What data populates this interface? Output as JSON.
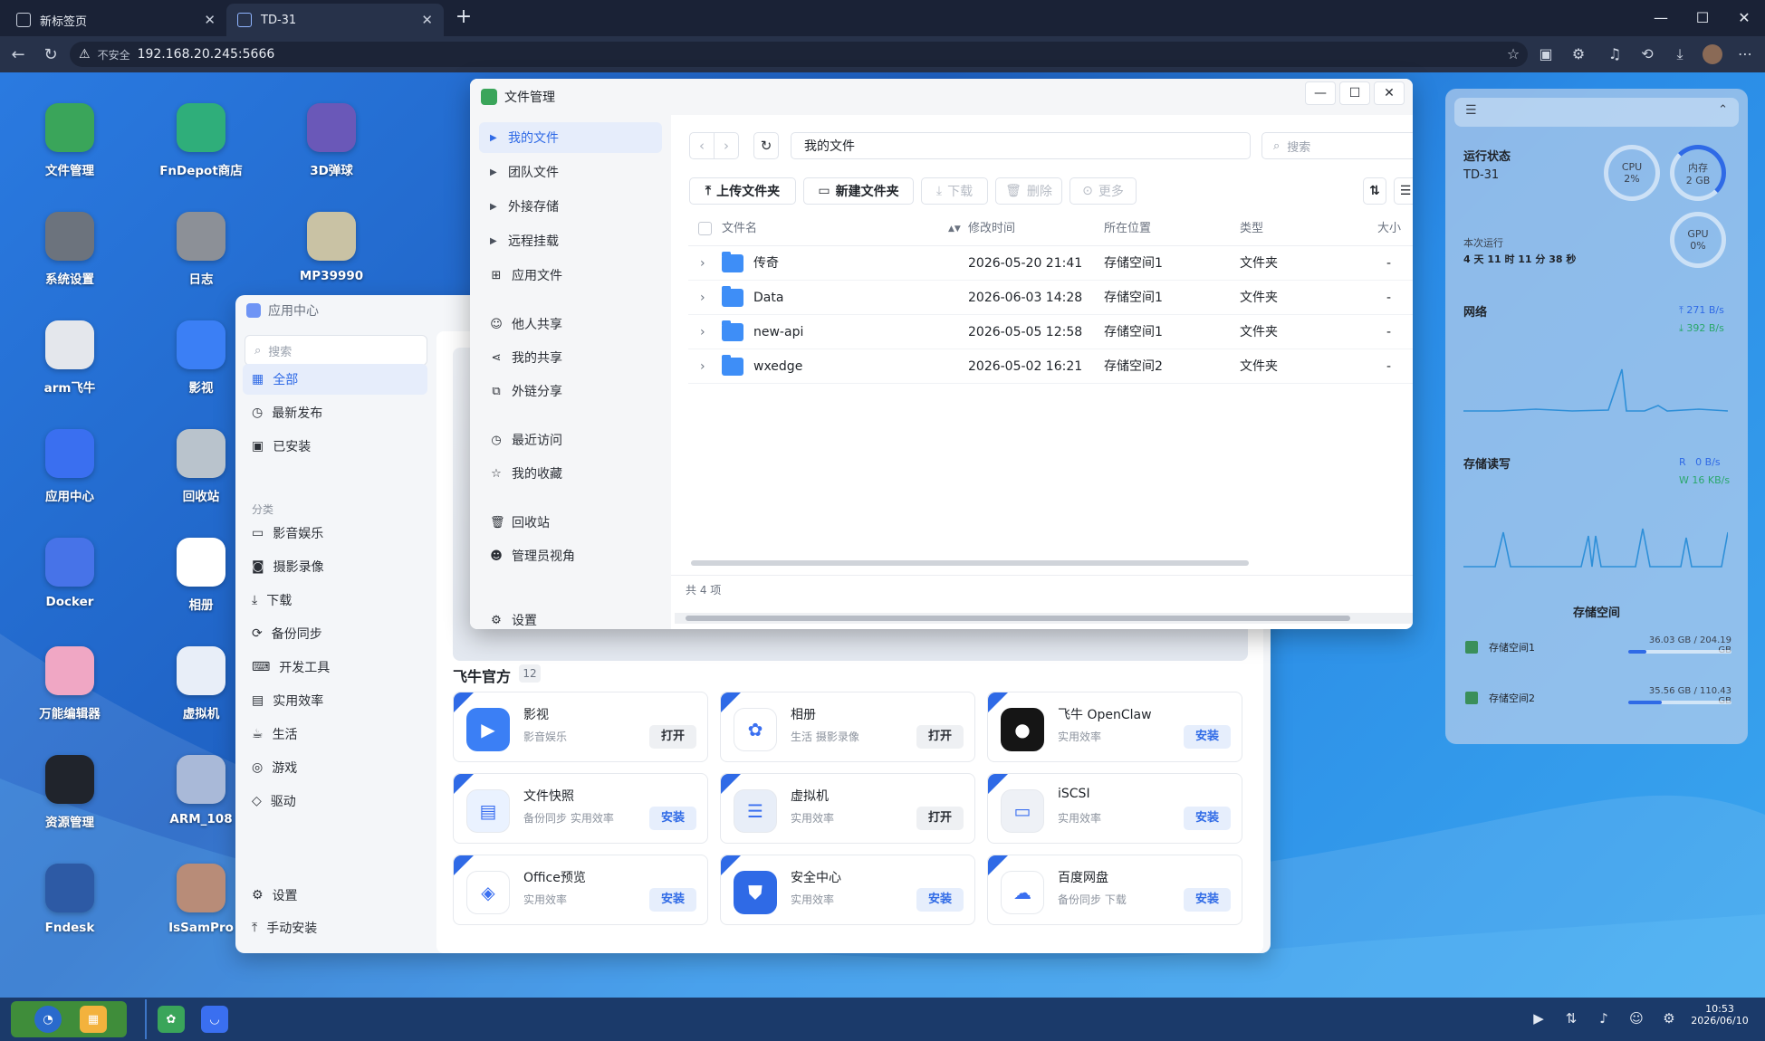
{
  "browser": {
    "tabs": [
      {
        "title": "新标签页"
      },
      {
        "title": "TD-31"
      }
    ],
    "insecure_label": "不安全",
    "url": "192.168.20.245:5666"
  },
  "desktop_icons": [
    {
      "label": "文件管理",
      "icon": "sunflower-icon",
      "color": "#3aa55a"
    },
    {
      "label": "FnDepot商店",
      "icon": "store-icon",
      "color": "#2fae7a"
    },
    {
      "label": "3D弹球",
      "icon": "pinball-icon",
      "color": "#6a58b8"
    },
    {
      "label": "系统设置",
      "icon": "gear-icon",
      "color": "#6c737d"
    },
    {
      "label": "日志",
      "icon": "log-icon",
      "color": "#8c9097"
    },
    {
      "label": "MP39990",
      "icon": "socket-icon",
      "color": "#c9c2a4"
    },
    {
      "label": "arm飞牛",
      "icon": "monitor-icon",
      "color": "#e4e7ec"
    },
    {
      "label": "影视",
      "icon": "video-icon",
      "color": "#3b7ff5"
    },
    {
      "label": "应用中心",
      "icon": "store-bag-icon",
      "color": "#3a6ff0"
    },
    {
      "label": "回收站",
      "icon": "trash-icon",
      "color": "#b9c3cc"
    },
    {
      "label": "Docker",
      "icon": "docker-icon",
      "color": "#4773e8"
    },
    {
      "label": "相册",
      "icon": "photos-icon",
      "color": "#ffffff"
    },
    {
      "label": "万能编辑器",
      "icon": "editor-icon",
      "color": "#f0a7c4"
    },
    {
      "label": "虚拟机",
      "icon": "vm-icon",
      "color": "#e8eef8"
    },
    {
      "label": "资源管理",
      "icon": "monitor-wave-icon",
      "color": "#20242c"
    },
    {
      "label": "ARM_108",
      "icon": "anime-girl-icon",
      "color": "#a9b9d8"
    },
    {
      "label": "Fndesk",
      "icon": "paw-icon",
      "color": "#2d5aa5"
    },
    {
      "label": "IsSamPro",
      "icon": "anime-girl2-icon",
      "color": "#b88c78"
    }
  ],
  "app_center": {
    "title": "应用中心",
    "search_placeholder": "搜索",
    "nav": [
      {
        "label": "全部",
        "icon": "grid-icon"
      },
      {
        "label": "最新发布",
        "icon": "clock-icon"
      },
      {
        "label": "已安装",
        "icon": "installed-icon"
      }
    ],
    "category_label": "分类",
    "categories": [
      {
        "label": "影音娱乐",
        "icon": "media-icon"
      },
      {
        "label": "摄影录像",
        "icon": "camera-icon"
      },
      {
        "label": "下载",
        "icon": "download-icon"
      },
      {
        "label": "备份同步",
        "icon": "sync-icon"
      },
      {
        "label": "开发工具",
        "icon": "code-icon"
      },
      {
        "label": "实用效率",
        "icon": "briefcase-icon"
      },
      {
        "label": "生活",
        "icon": "coffee-icon"
      },
      {
        "label": "游戏",
        "icon": "gamepad-icon"
      },
      {
        "label": "驱动",
        "icon": "cube-icon"
      }
    ],
    "bottom": [
      {
        "label": "设置",
        "icon": "gear-icon"
      },
      {
        "label": "手动安装",
        "icon": "upload-icon"
      }
    ],
    "section_title": "飞牛官方",
    "section_count": "12",
    "cards": [
      {
        "name": "影视",
        "sub": "影音娱乐",
        "btn": "打开",
        "kind": "open",
        "color": "#3b7ff5",
        "glyph": "▶"
      },
      {
        "name": "相册",
        "sub": "生活 摄影录像",
        "btn": "打开",
        "kind": "open",
        "color": "#ffffff",
        "glyph": "✿"
      },
      {
        "name": "飞牛 OpenClaw",
        "sub": "实用效率",
        "btn": "安装",
        "kind": "inst",
        "color": "#151515",
        "glyph": "●"
      },
      {
        "name": "文件快照",
        "sub": "备份同步 实用效率",
        "btn": "安装",
        "kind": "inst",
        "color": "#eaf2ff",
        "glyph": "▤"
      },
      {
        "name": "虚拟机",
        "sub": "实用效率",
        "btn": "打开",
        "kind": "open",
        "color": "#e8eef8",
        "glyph": "☰"
      },
      {
        "name": "iSCSI",
        "sub": "实用效率",
        "btn": "安装",
        "kind": "inst",
        "color": "#eef1f6",
        "glyph": "▭"
      },
      {
        "name": "Office预览",
        "sub": "实用效率",
        "btn": "安装",
        "kind": "inst",
        "color": "#ffffff",
        "glyph": "◈"
      },
      {
        "name": "安全中心",
        "sub": "实用效率",
        "btn": "安装",
        "kind": "inst",
        "color": "#2f6ae6",
        "glyph": "⛊"
      },
      {
        "name": "百度网盘",
        "sub": "备份同步 下载",
        "btn": "安装",
        "kind": "inst",
        "color": "#ffffff",
        "glyph": "☁"
      }
    ]
  },
  "file_manager": {
    "title": "文件管理",
    "sidebar": [
      {
        "label": "我的文件",
        "icon": "chevron-right-icon",
        "selected": true
      },
      {
        "label": "团队文件",
        "icon": "chevron-right-icon"
      },
      {
        "label": "外接存储",
        "icon": "chevron-right-icon"
      },
      {
        "label": "远程挂载",
        "icon": "chevron-right-icon"
      },
      {
        "label": "应用文件",
        "icon": "apps-icon"
      },
      {
        "label": "他人共享",
        "icon": "user-share-icon"
      },
      {
        "label": "我的共享",
        "icon": "share-icon"
      },
      {
        "label": "外链分享",
        "icon": "link-icon"
      },
      {
        "label": "最近访问",
        "icon": "clock-icon"
      },
      {
        "label": "我的收藏",
        "icon": "star-icon"
      },
      {
        "label": "回收站",
        "icon": "trash-icon"
      },
      {
        "label": "管理员视角",
        "icon": "admin-icon"
      },
      {
        "label": "设置",
        "icon": "gear-icon"
      }
    ],
    "path": "我的文件",
    "search_placeholder": "搜索",
    "toolbar": {
      "upload": "上传文件夹",
      "new_folder": "新建文件夹",
      "download": "下载",
      "delete": "删除",
      "more": "更多"
    },
    "columns": {
      "name": "文件名",
      "modified": "修改时间",
      "location": "所在位置",
      "type": "类型",
      "size": "大小"
    },
    "rows": [
      {
        "name": "传奇",
        "modified": "2026-05-20 21:41",
        "location": "存储空间1",
        "type": "文件夹",
        "size": "-"
      },
      {
        "name": "Data",
        "modified": "2026-06-03 14:28",
        "location": "存储空间1",
        "type": "文件夹",
        "size": "-"
      },
      {
        "name": "new-api",
        "modified": "2026-05-05 12:58",
        "location": "存储空间1",
        "type": "文件夹",
        "size": "-"
      },
      {
        "name": "wxedge",
        "modified": "2026-05-02 16:21",
        "location": "存储空间2",
        "type": "文件夹",
        "size": "-"
      }
    ],
    "footer": "共 4 项"
  },
  "status": {
    "title": "运行状态",
    "device": "TD-31",
    "uptime_label": "本次运行",
    "uptime": "4 天 11 时 11 分 38 秒",
    "cpu": {
      "label": "CPU",
      "value": "2%",
      "fraction": 0.02
    },
    "mem": {
      "label": "内存",
      "value": "2 GB",
      "fraction": 0.35
    },
    "gpu": {
      "label": "GPU",
      "value": "0%",
      "fraction": 0.0
    },
    "network": {
      "label": "网络",
      "up": "271 B/s",
      "down": "392 B/s"
    },
    "storage_io": {
      "label": "存储读写",
      "r_label": "R",
      "r_value": "0 B/s",
      "w_label": "W",
      "w_value": "16 KB/s"
    },
    "storage_title": "存储空间",
    "volumes": [
      {
        "name": "存储空间1",
        "used": "36.03 GB",
        "total": "204.19 GB",
        "fraction": 0.176
      },
      {
        "name": "存储空间2",
        "used": "35.56 GB",
        "total": "110.43 GB",
        "fraction": 0.322
      }
    ]
  },
  "taskbar": {
    "time": "10:53",
    "date": "2026/06/10"
  }
}
